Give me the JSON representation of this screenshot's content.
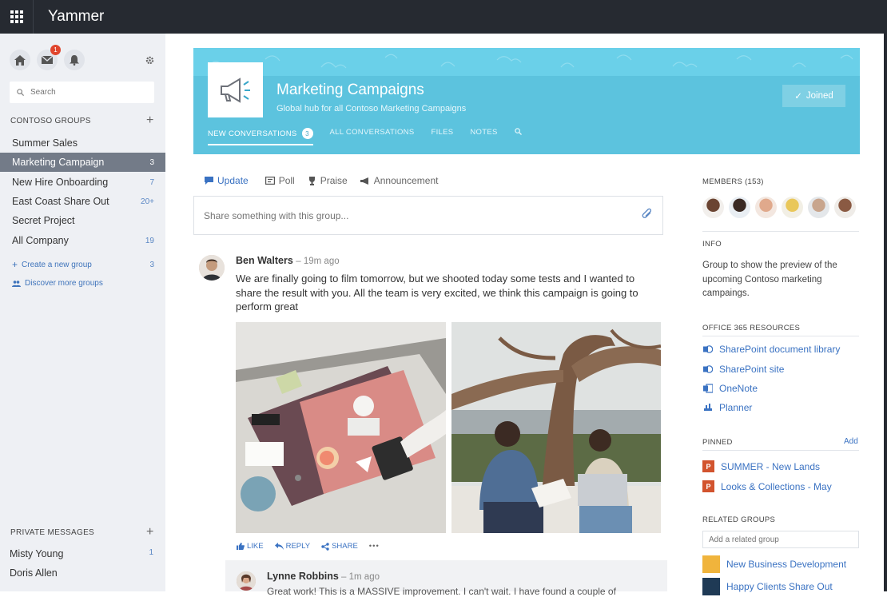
{
  "app": {
    "title": "Yammer"
  },
  "colors": {
    "topbar": "#262a31",
    "banner": "#5cc3de",
    "link": "#3a72c2",
    "active_group": "#737b88",
    "badge": "#e0452d"
  },
  "nav": {
    "icons": [
      "home-icon",
      "mail-icon",
      "bell-icon"
    ],
    "mail_badge": "1",
    "settings_icon": "gear-icon",
    "search_placeholder": "Search"
  },
  "groups": {
    "header": "CONTOSO GROUPS",
    "items": [
      {
        "label": "Summer Sales",
        "count": ""
      },
      {
        "label": "Marketing Campaign",
        "count": "3",
        "active": true
      },
      {
        "label": "New Hire Onboarding",
        "count": "7"
      },
      {
        "label": "East Coast Share Out",
        "count": "20+"
      },
      {
        "label": "Secret Project",
        "count": ""
      },
      {
        "label": "All Company",
        "count": "19"
      }
    ],
    "create": {
      "label": "Create a new group",
      "count": "3"
    },
    "discover": {
      "label": "Discover more groups"
    }
  },
  "private_messages": {
    "header": "PRIVATE MESSAGES",
    "items": [
      {
        "name": "Misty Young",
        "count": "1"
      },
      {
        "name": "Doris Allen",
        "count": ""
      }
    ]
  },
  "banner": {
    "title": "Marketing Campaigns",
    "subtitle": "Global hub for all Contoso Marketing Campaigns",
    "joined": "Joined",
    "tabs": [
      {
        "label": "NEW CONVERSATIONS",
        "badge": "3"
      },
      {
        "label": "ALL CONVERSATIONS"
      },
      {
        "label": "FILES"
      },
      {
        "label": "NOTES"
      }
    ]
  },
  "publisher": {
    "tabs": [
      "Update",
      "Poll",
      "Praise",
      "Announcement"
    ],
    "placeholder": "Share something with this group..."
  },
  "post": {
    "author": "Ben Walters",
    "time": "19m ago",
    "body": "We are finally going to film tomorrow, but we shooted today some tests and I wanted to share the result with you. All the team is very excited, we think this campaign is going to perform great",
    "actions": [
      "LIKE",
      "REPLY",
      "SHARE"
    ]
  },
  "reply": {
    "author": "Lynne Robbins",
    "time": "1m ago",
    "body": "Great work! This is a MASSIVE improvement. I can't wait. I have found a couple of"
  },
  "right": {
    "members_header": "MEMBERS (153)",
    "info_header": "INFO",
    "info_text": "Group to show the preview of the upcoming Contoso marketing campaings.",
    "resources_header": "OFFICE 365 RESOURCES",
    "resources": [
      "SharePoint document library",
      "SharePoint site",
      "OneNote",
      "Planner"
    ],
    "pinned_header": "PINNED",
    "pinned_add": "Add",
    "pinned": [
      "SUMMER - New Lands",
      "Looks & Collections - May"
    ],
    "related_header": "RELATED GROUPS",
    "related_placeholder": "Add a related group",
    "related": [
      {
        "label": "New Business Development",
        "color": "#f0b43c"
      },
      {
        "label": "Happy Clients Share Out",
        "color": "#1f3a55"
      }
    ]
  }
}
